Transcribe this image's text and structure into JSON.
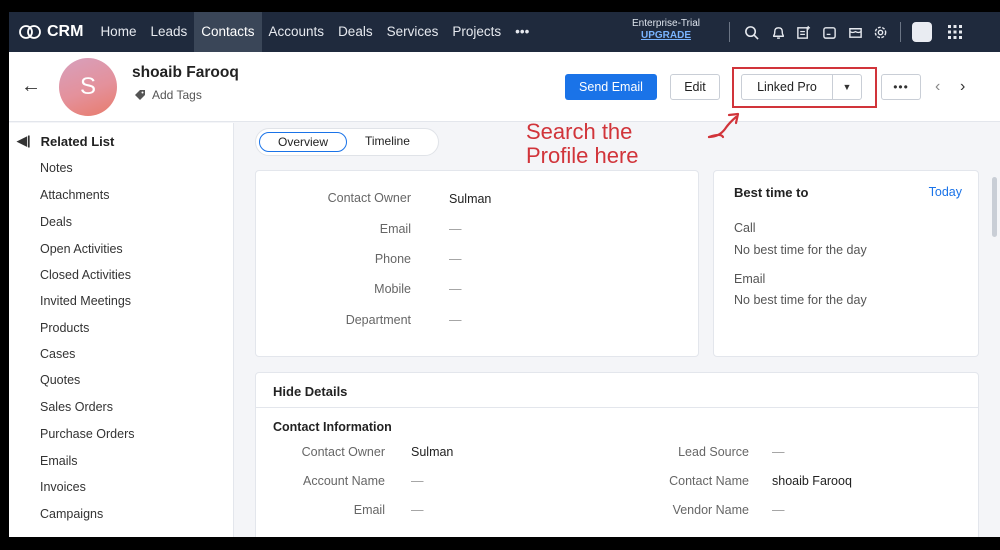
{
  "nav": {
    "brand": "CRM",
    "items": [
      {
        "label": "Home",
        "active": false
      },
      {
        "label": "Leads",
        "active": false
      },
      {
        "label": "Contacts",
        "active": true
      },
      {
        "label": "Accounts",
        "active": false
      },
      {
        "label": "Deals",
        "active": false
      },
      {
        "label": "Services",
        "active": false
      },
      {
        "label": "Projects",
        "active": false
      },
      {
        "label": "•••",
        "active": false
      }
    ],
    "trial_label": "Enterprise-Trial",
    "upgrade_label": "UPGRADE",
    "icons": [
      "search-icon",
      "bell-icon",
      "compose-icon",
      "calendar-icon",
      "marketplace-icon",
      "gear-icon",
      "avatar",
      "apps-grid-icon"
    ]
  },
  "record": {
    "avatar_letter": "S",
    "name": "shoaib Farooq",
    "add_tags": "Add Tags",
    "send_email": "Send Email",
    "edit": "Edit",
    "linked_pro": "Linked Pro",
    "more": "•••"
  },
  "sidebar": {
    "header": "Related List",
    "items": [
      "Notes",
      "Attachments",
      "Deals",
      "Open Activities",
      "Closed Activities",
      "Invited Meetings",
      "Products",
      "Cases",
      "Quotes",
      "Sales Orders",
      "Purchase Orders",
      "Emails",
      "Invoices",
      "Campaigns"
    ]
  },
  "tabs": {
    "overview": "Overview",
    "timeline": "Timeline"
  },
  "annotation": {
    "line1": "Search the",
    "line2": "Profile here"
  },
  "summary": {
    "rows": [
      {
        "label": "Contact Owner",
        "value": "Sulman"
      },
      {
        "label": "Email",
        "value": "—"
      },
      {
        "label": "Phone",
        "value": "—"
      },
      {
        "label": "Mobile",
        "value": "—"
      },
      {
        "label": "Department",
        "value": "—"
      }
    ]
  },
  "best_time": {
    "title": "Best time to",
    "today": "Today",
    "call_label": "Call",
    "call_text": "No best time for the day",
    "email_label": "Email",
    "email_text": "No best time for the day"
  },
  "details": {
    "hide_details": "Hide Details",
    "section_title": "Contact Information",
    "left": [
      {
        "label": "Contact Owner",
        "value": "Sulman"
      },
      {
        "label": "Account Name",
        "value": "—"
      },
      {
        "label": "Email",
        "value": "—"
      }
    ],
    "right": [
      {
        "label": "Lead Source",
        "value": "—"
      },
      {
        "label": "Contact Name",
        "value": "shoaib Farooq"
      },
      {
        "label": "Vendor Name",
        "value": "—"
      }
    ]
  }
}
